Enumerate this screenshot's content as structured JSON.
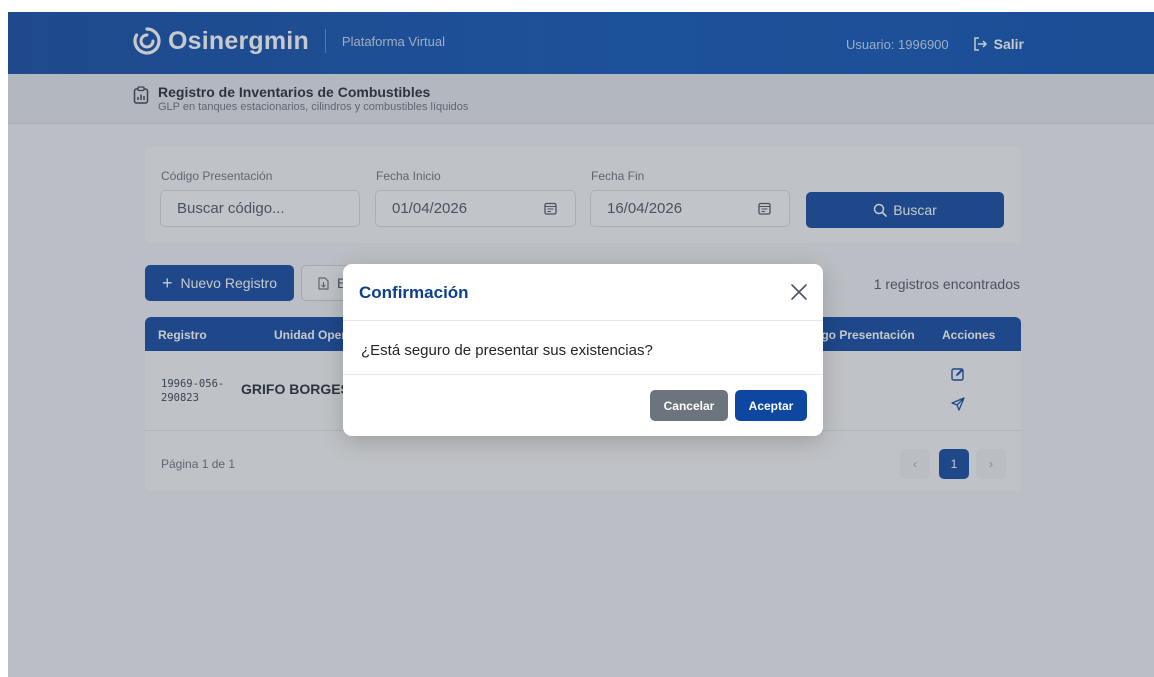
{
  "header": {
    "brand_name": "Osinergmin",
    "platform": "Plataforma Virtual",
    "user_label": "Usuario: 1996900",
    "logout_label": "Salir"
  },
  "subheader": {
    "title": "Registro de Inventarios de Combustibles",
    "description": "GLP en tanques estacionarios, cilindros y combustibles líquidos"
  },
  "filters": {
    "code_label": "Código Presentación",
    "code_placeholder": "Buscar código...",
    "start_label": "Fecha Inicio",
    "start_value": "01/04/2026",
    "end_label": "Fecha Fin",
    "end_value": "16/04/2026",
    "search_label": "Buscar"
  },
  "actions": {
    "new_label": "Nuevo Registro",
    "export_label": "E",
    "found_label": "1 registros encontrados"
  },
  "table": {
    "headers": [
      "Registro",
      "Unidad Oper",
      "igo Presentación",
      "Acciones"
    ],
    "rows": [
      {
        "registro": "19969-056-290823",
        "unidad": "GRIFO BORGES"
      }
    ],
    "page_label": "Página 1 de 1",
    "prev": "‹",
    "current_page": "1",
    "next": "›"
  },
  "modal": {
    "title": "Confirmación",
    "message": "¿Está seguro de presentar sus existencias?",
    "cancel_label": "Cancelar",
    "accept_label": "Aceptar"
  },
  "colors": {
    "primary": "#0d47a1",
    "secondary": "#6c757d",
    "header_bg": "#0b55b8"
  },
  "icons": [
    "logo-icon",
    "logout-icon",
    "clipboard-chart-icon",
    "calendar-icon",
    "search-icon",
    "plus-icon",
    "file-icon",
    "edit-icon",
    "send-icon",
    "close-icon"
  ]
}
